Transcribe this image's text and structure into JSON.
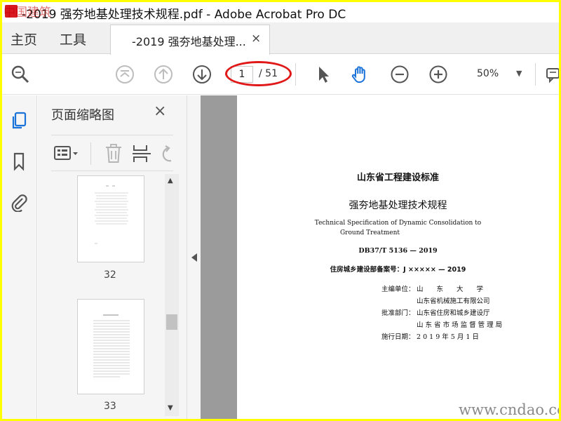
{
  "window": {
    "title": "-2019 强夯地基处理技术规程.pdf - Adobe Acrobat Pro DC",
    "watermark_top": "中国建筑"
  },
  "tabs": {
    "home": "主页",
    "tools": "工具",
    "document": "-2019 强夯地基处理...",
    "close": "×"
  },
  "toolbar": {
    "page_current": "1",
    "page_total": "/ 51",
    "zoom": "50%"
  },
  "panel": {
    "title": "页面缩略图",
    "close": "×",
    "thumbnails": [
      {
        "page": "32"
      },
      {
        "page": "33"
      }
    ]
  },
  "document": {
    "category": "山东省工程建设标准",
    "title_cn": "强夯地基处理技术规程",
    "title_en_line1": "Technical Specification of Dynamic Consolidation to",
    "title_en_line2": "Ground Treatment",
    "code": "DB37/T 5136 — 2019",
    "record": "住房城乡建设部备案号：J ××××× — 2019",
    "rows": [
      {
        "label": "主编单位：",
        "value": "山　　东　　大　　学"
      },
      {
        "label": "",
        "value": "山东省机械施工有限公司"
      },
      {
        "label": "批准部门：",
        "value": "山东省住房和城乡建设厅"
      },
      {
        "label": "",
        "value": "山 东 省 市 场 监 督 管 理 局"
      },
      {
        "label": "施行日期：",
        "value": "2 0 1 9 年 5 月 1 日"
      }
    ]
  },
  "watermark": "www.cndao.com",
  "colors": {
    "accent_blue": "#1a73d9",
    "highlight_red": "#e01818",
    "border_yellow": "#ffff00"
  }
}
